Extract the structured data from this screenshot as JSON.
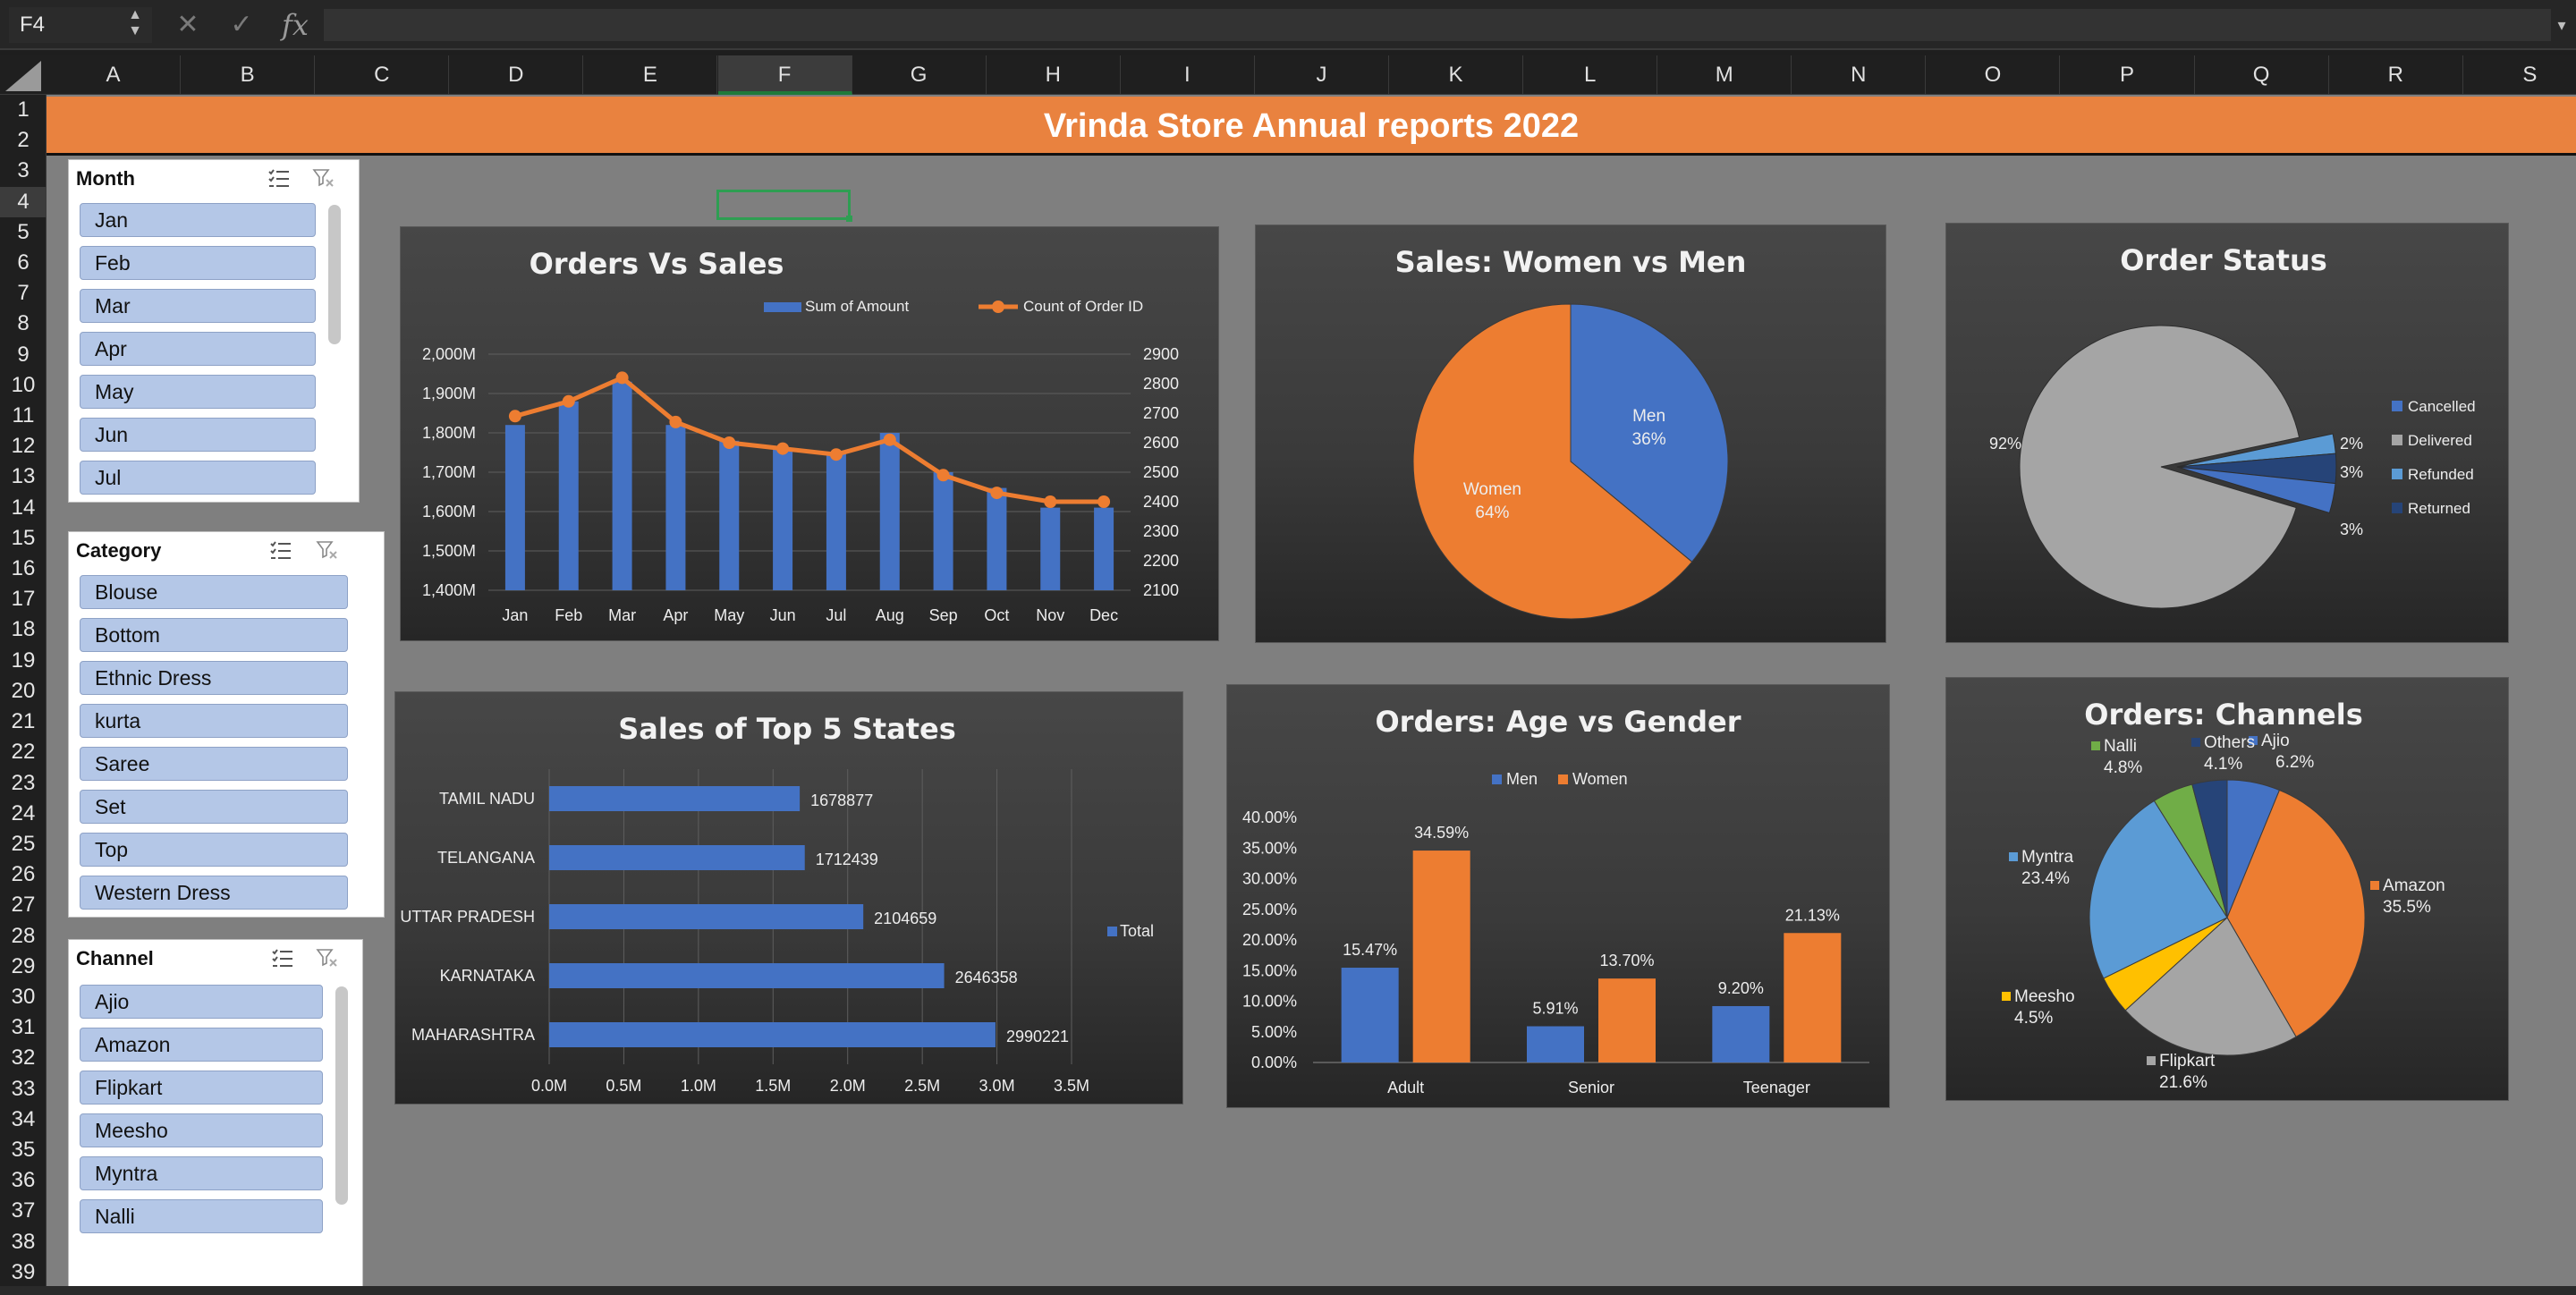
{
  "formula_bar": {
    "name_box": "F4",
    "cancel_icon": "✕",
    "enter_icon": "✓",
    "fx_label": "fx",
    "formula": ""
  },
  "columns": [
    "A",
    "B",
    "C",
    "D",
    "E",
    "F",
    "G",
    "H",
    "I",
    "J",
    "K",
    "L",
    "M",
    "N",
    "O",
    "P",
    "Q",
    "R",
    "S"
  ],
  "rows": [
    "1",
    "2",
    "3",
    "4",
    "5",
    "6",
    "7",
    "8",
    "9",
    "10",
    "11",
    "12",
    "13",
    "14",
    "15",
    "16",
    "17",
    "18",
    "19",
    "20",
    "21",
    "22",
    "23",
    "24",
    "25",
    "26",
    "27",
    "28",
    "29",
    "30",
    "31",
    "32",
    "33",
    "34",
    "35",
    "36",
    "37",
    "38",
    "39"
  ],
  "selected_cell": {
    "column": "F",
    "row": "4"
  },
  "banner": {
    "title": "Vrinda Store Annual reports 2022"
  },
  "slicers": {
    "month": {
      "title": "Month",
      "items": [
        "Jan",
        "Feb",
        "Mar",
        "Apr",
        "May",
        "Jun",
        "Jul"
      ]
    },
    "category": {
      "title": "Category",
      "items": [
        "Blouse",
        "Bottom",
        "Ethnic Dress",
        "kurta",
        "Saree",
        "Set",
        "Top",
        "Western Dress"
      ]
    },
    "channel": {
      "title": "Channel",
      "items": [
        "Ajio",
        "Amazon",
        "Flipkart",
        "Meesho",
        "Myntra",
        "Nalli"
      ]
    }
  },
  "colors": {
    "accent_orange": "#ed7d31",
    "accent_blue": "#4472c4",
    "gray": "#a5a5a5",
    "yellow": "#ffc000",
    "light_blue": "#5b9bd5",
    "green": "#70ad47",
    "navy": "#264478",
    "banner": "#e9823f",
    "sheet_bg": "#7f7f7f",
    "slicer_item": "#b4c7e7"
  },
  "chart_data": [
    {
      "id": "orders_vs_sales",
      "type": "bar",
      "title": "Orders Vs Sales",
      "categories": [
        "Jan",
        "Feb",
        "Mar",
        "Apr",
        "May",
        "Jun",
        "Jul",
        "Aug",
        "Sep",
        "Oct",
        "Nov",
        "Dec"
      ],
      "series": [
        {
          "name": "Sum of Amount",
          "type": "bar",
          "axis": "left",
          "values": [
            1820,
            1880,
            1930,
            1820,
            1780,
            1760,
            1750,
            1800,
            1700,
            1660,
            1610,
            1610
          ]
        },
        {
          "name": "Count of Order ID",
          "type": "line",
          "axis": "right",
          "values": [
            2690,
            2740,
            2820,
            2670,
            2600,
            2580,
            2560,
            2610,
            2490,
            2430,
            2400,
            2400
          ]
        }
      ],
      "y_left": {
        "ylim": [
          1400,
          2000
        ],
        "ticks": [
          "1,400M",
          "1,500M",
          "1,600M",
          "1,700M",
          "1,800M",
          "1,900M",
          "2,000M"
        ]
      },
      "y_right": {
        "ylim": [
          2100,
          2900
        ],
        "ticks": [
          "2100",
          "2200",
          "2300",
          "2400",
          "2500",
          "2600",
          "2700",
          "2800",
          "2900"
        ]
      },
      "legend": "top",
      "grid": true
    },
    {
      "id": "sales_women_vs_men",
      "type": "pie",
      "title": "Sales: Women vs Men",
      "slices": [
        {
          "label": "Men",
          "value": 36,
          "text": "36%",
          "color": "#4472c4"
        },
        {
          "label": "Women",
          "value": 64,
          "text": "64%",
          "color": "#ed7d31"
        }
      ]
    },
    {
      "id": "order_status",
      "type": "pie",
      "title": "Order Status",
      "slices": [
        {
          "label": "Cancelled",
          "value": 3,
          "text": "3%",
          "color": "#4472c4"
        },
        {
          "label": "Delivered",
          "value": 92,
          "text": "92%",
          "color": "#a5a5a5"
        },
        {
          "label": "Refunded",
          "value": 2,
          "text": "2%",
          "color": "#5b9bd5"
        },
        {
          "label": "Returned",
          "value": 3,
          "text": "3%",
          "color": "#264478"
        }
      ],
      "legend": "right"
    },
    {
      "id": "sales_top_5_states",
      "type": "bar",
      "orientation": "horizontal",
      "title": "Sales of Top 5 States",
      "categories": [
        "TAMIL NADU",
        "TELANGANA",
        "UTTAR PRADESH",
        "KARNATAKA",
        "MAHARASHTRA"
      ],
      "series": [
        {
          "name": "Total",
          "values": [
            1678877,
            1712439,
            2104659,
            2646358,
            2990221
          ]
        }
      ],
      "xlim": [
        0,
        3500000
      ],
      "x_ticks": [
        "0.0M",
        "0.5M",
        "1.0M",
        "1.5M",
        "2.0M",
        "2.5M",
        "3.0M",
        "3.5M"
      ],
      "legend": "right",
      "grid": true
    },
    {
      "id": "orders_age_vs_gender",
      "type": "bar",
      "title": "Orders: Age vs Gender",
      "categories": [
        "Adult",
        "Senior",
        "Teenager"
      ],
      "series": [
        {
          "name": "Men",
          "values": [
            15.47,
            5.91,
            9.2
          ],
          "labels": [
            "15.47%",
            "5.91%",
            "9.20%"
          ]
        },
        {
          "name": "Women",
          "values": [
            34.59,
            13.7,
            21.13
          ],
          "labels": [
            "34.59%",
            "13.70%",
            "21.13%"
          ]
        }
      ],
      "ylim": [
        0,
        40
      ],
      "y_ticks": [
        "0.00%",
        "5.00%",
        "10.00%",
        "15.00%",
        "20.00%",
        "25.00%",
        "30.00%",
        "35.00%",
        "40.00%"
      ],
      "legend": "top"
    },
    {
      "id": "orders_channels",
      "type": "pie",
      "title": "Orders: Channels",
      "slices": [
        {
          "label": "Ajio",
          "value": 6.2,
          "text": "6.2%",
          "color": "#4472c4"
        },
        {
          "label": "Amazon",
          "value": 35.5,
          "text": "35.5%",
          "color": "#ed7d31"
        },
        {
          "label": "Flipkart",
          "value": 21.6,
          "text": "21.6%",
          "color": "#a5a5a5"
        },
        {
          "label": "Meesho",
          "value": 4.5,
          "text": "4.5%",
          "color": "#ffc000"
        },
        {
          "label": "Myntra",
          "value": 23.4,
          "text": "23.4%",
          "color": "#5b9bd5"
        },
        {
          "label": "Nalli",
          "value": 4.8,
          "text": "4.8%",
          "color": "#70ad47"
        },
        {
          "label": "Others",
          "value": 4.1,
          "text": "4.1%",
          "color": "#264478"
        }
      ]
    }
  ]
}
